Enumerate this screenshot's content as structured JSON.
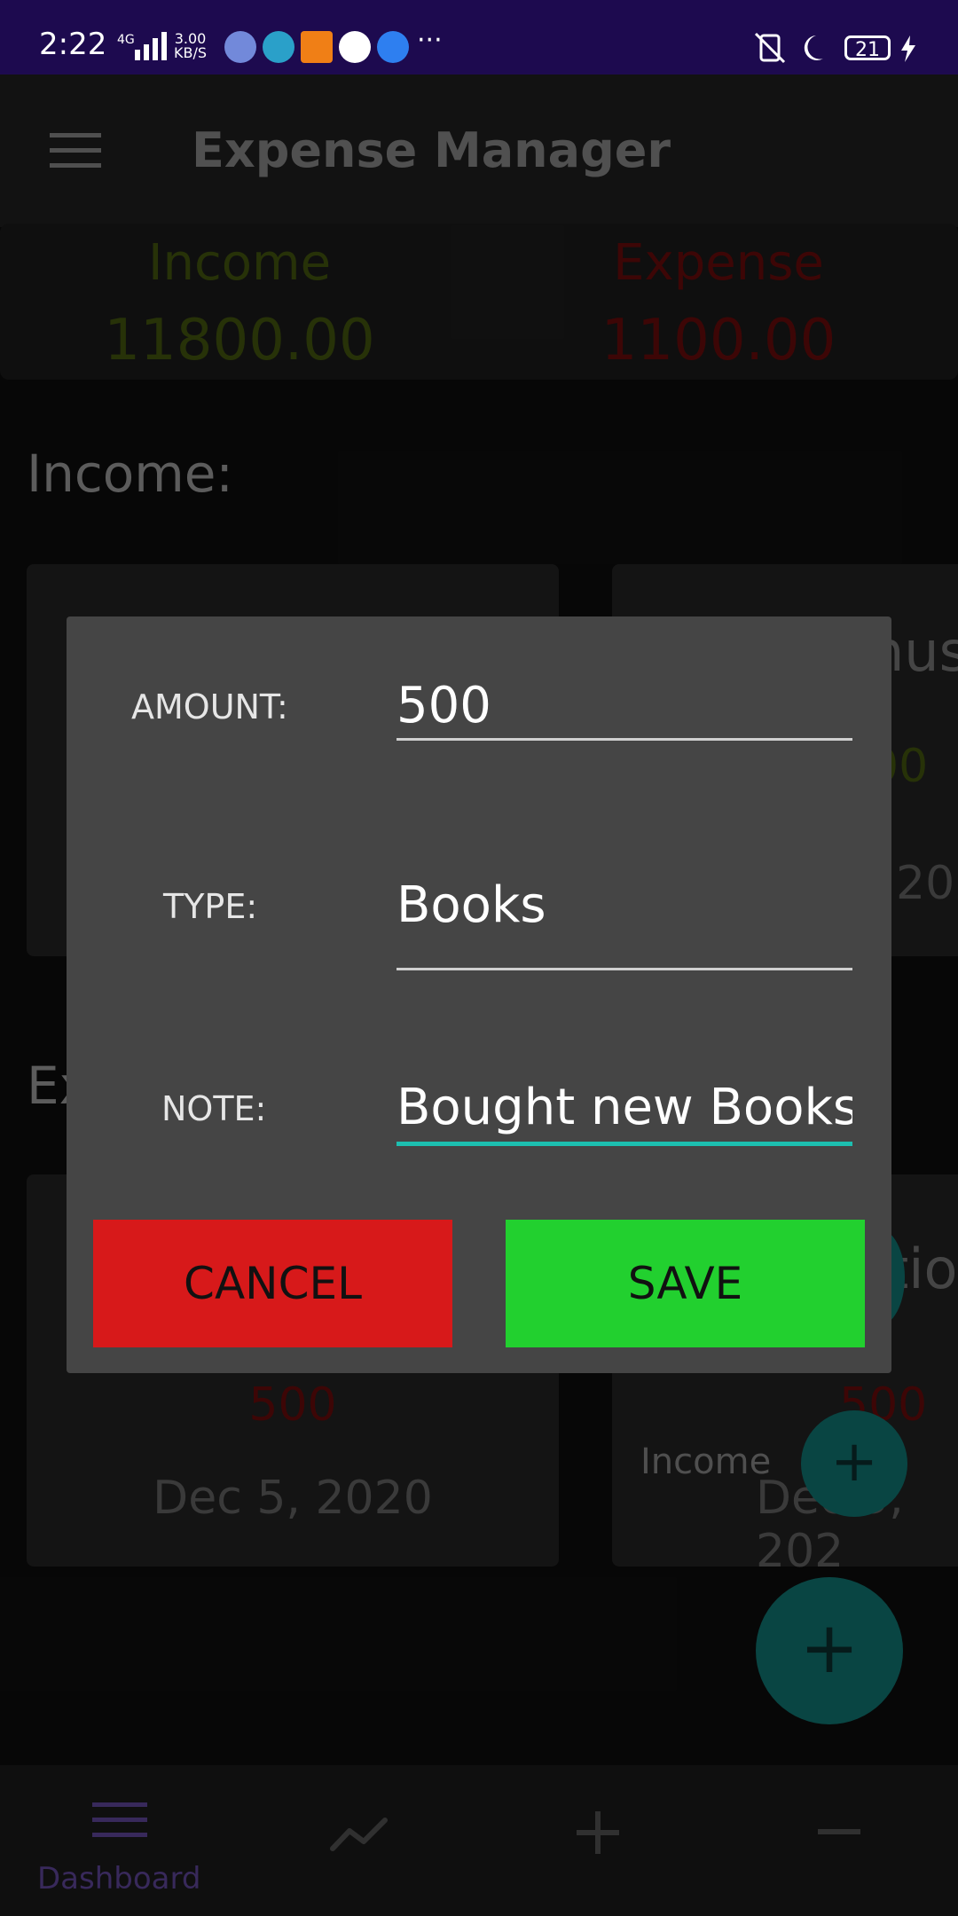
{
  "status_bar": {
    "time": "2:22",
    "network": "4G",
    "speed_value": "3.00",
    "speed_unit": "KB/S",
    "battery": "21",
    "more": "···"
  },
  "app_bar": {
    "title": "Expense Manager"
  },
  "summary": {
    "income_label": "Income",
    "income_value": "11800.00",
    "expense_label": "Expense",
    "expense_value": "1100.00",
    "income_color": "#3c4e0d",
    "expense_color": "#5e0a0a"
  },
  "income_section": {
    "title": "Income:",
    "card2_title_partial": "nus",
    "card2_amount_partial": "00",
    "card2_date_partial": "202"
  },
  "expense_section": {
    "title_partial": "Ex",
    "card1_amount": "500",
    "card1_date": "Dec 5, 2020",
    "card2_title_partial": "tio",
    "card2_amount": "500",
    "card2_date_partial": "Dec 5, 202"
  },
  "fab_mini_label": "Income",
  "dialog": {
    "amount_label": "AMOUNT:",
    "amount_value": "500",
    "type_label": "TYPE:",
    "type_value": "Books",
    "note_label": "NOTE:",
    "note_value": "Bought new Books",
    "cancel_label": "CANCEL",
    "save_label": "SAVE",
    "cancel_color": "#d7191a",
    "save_color": "#22d02f",
    "accent_color": "#1dbfb0"
  },
  "bottom_nav": {
    "items": [
      {
        "label": "Dashboard",
        "icon": "menu-icon"
      },
      {
        "label": "",
        "icon": "chart-icon"
      },
      {
        "label": "",
        "icon": "plus-icon"
      },
      {
        "label": "",
        "icon": "minus-icon"
      }
    ]
  }
}
